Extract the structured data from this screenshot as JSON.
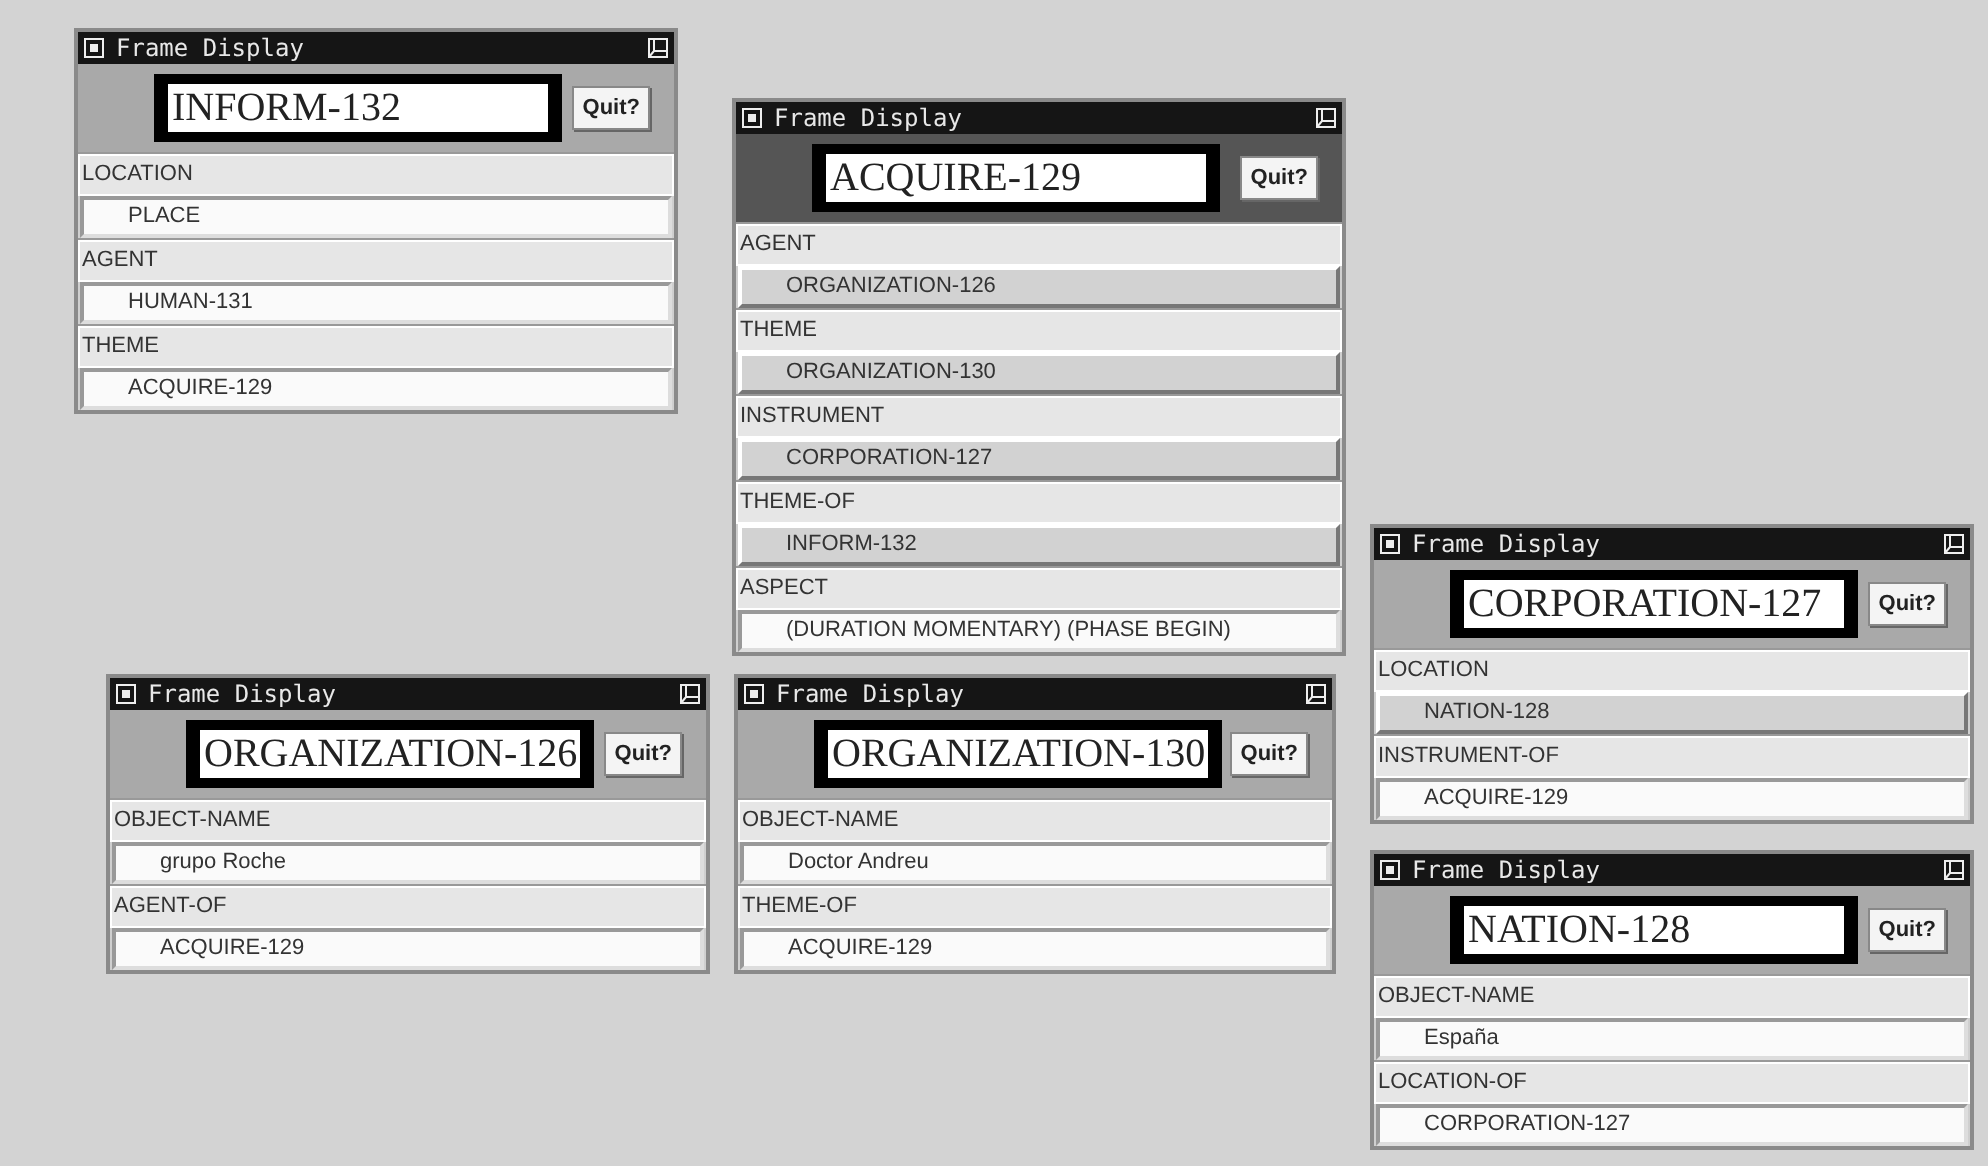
{
  "windows": [
    {
      "title": "Frame Display",
      "frame": "INFORM-132",
      "quit": "Quit?",
      "active": false,
      "slots": [
        {
          "label": "LOCATION",
          "value": "PLACE",
          "highlighted": false
        },
        {
          "label": "AGENT",
          "value": "HUMAN-131",
          "highlighted": false
        },
        {
          "label": "THEME",
          "value": "ACQUIRE-129",
          "highlighted": false
        }
      ]
    },
    {
      "title": "Frame Display",
      "frame": "ACQUIRE-129",
      "quit": "Quit?",
      "active": true,
      "slots": [
        {
          "label": "AGENT",
          "value": "ORGANIZATION-126",
          "highlighted": true
        },
        {
          "label": "THEME",
          "value": "ORGANIZATION-130",
          "highlighted": true
        },
        {
          "label": "INSTRUMENT",
          "value": "CORPORATION-127",
          "highlighted": true
        },
        {
          "label": "THEME-OF",
          "value": "INFORM-132",
          "highlighted": true
        },
        {
          "label": "ASPECT",
          "value": "(DURATION MOMENTARY) (PHASE BEGIN)",
          "highlighted": false
        }
      ]
    },
    {
      "title": "Frame Display",
      "frame": "ORGANIZATION-126",
      "quit": "Quit?",
      "active": false,
      "slots": [
        {
          "label": "OBJECT-NAME",
          "value": "grupo Roche",
          "highlighted": false
        },
        {
          "label": "AGENT-OF",
          "value": "ACQUIRE-129",
          "highlighted": false
        }
      ]
    },
    {
      "title": "Frame Display",
      "frame": "ORGANIZATION-130",
      "quit": "Quit?",
      "active": false,
      "slots": [
        {
          "label": "OBJECT-NAME",
          "value": "Doctor Andreu",
          "highlighted": false
        },
        {
          "label": "THEME-OF",
          "value": "ACQUIRE-129",
          "highlighted": false
        }
      ]
    },
    {
      "title": "Frame Display",
      "frame": "CORPORATION-127",
      "quit": "Quit?",
      "active": false,
      "slots": [
        {
          "label": "LOCATION",
          "value": "NATION-128",
          "highlighted": true
        },
        {
          "label": "INSTRUMENT-OF",
          "value": "ACQUIRE-129",
          "highlighted": false
        }
      ]
    },
    {
      "title": "Frame Display",
      "frame": "NATION-128",
      "quit": "Quit?",
      "active": false,
      "slots": [
        {
          "label": "OBJECT-NAME",
          "value": "España",
          "highlighted": false
        },
        {
          "label": "LOCATION-OF",
          "value": "CORPORATION-127",
          "highlighted": false
        }
      ]
    }
  ]
}
